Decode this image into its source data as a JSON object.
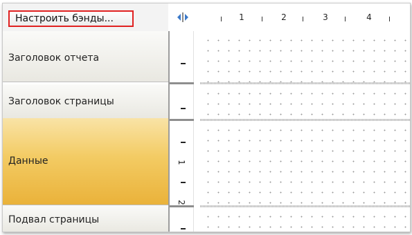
{
  "toolbar": {
    "configure_bands_label": "Настроить бэнды..."
  },
  "icons": {
    "splitter": "split-horizontal-icon"
  },
  "ruler": {
    "horizontal_numbers": [
      "1",
      "2",
      "3",
      "4"
    ],
    "vertical_numbers": [
      "1",
      "2"
    ]
  },
  "bands": [
    {
      "label": "Заголовок отчета",
      "selected": false
    },
    {
      "label": "Заголовок страницы",
      "selected": false
    },
    {
      "label": "Данные",
      "selected": true
    },
    {
      "label": "Подвал страницы",
      "selected": false
    }
  ],
  "colors": {
    "selected_band_top": "#f9e3a6",
    "selected_band_bottom": "#eab23a",
    "highlight_border": "#e02020"
  }
}
